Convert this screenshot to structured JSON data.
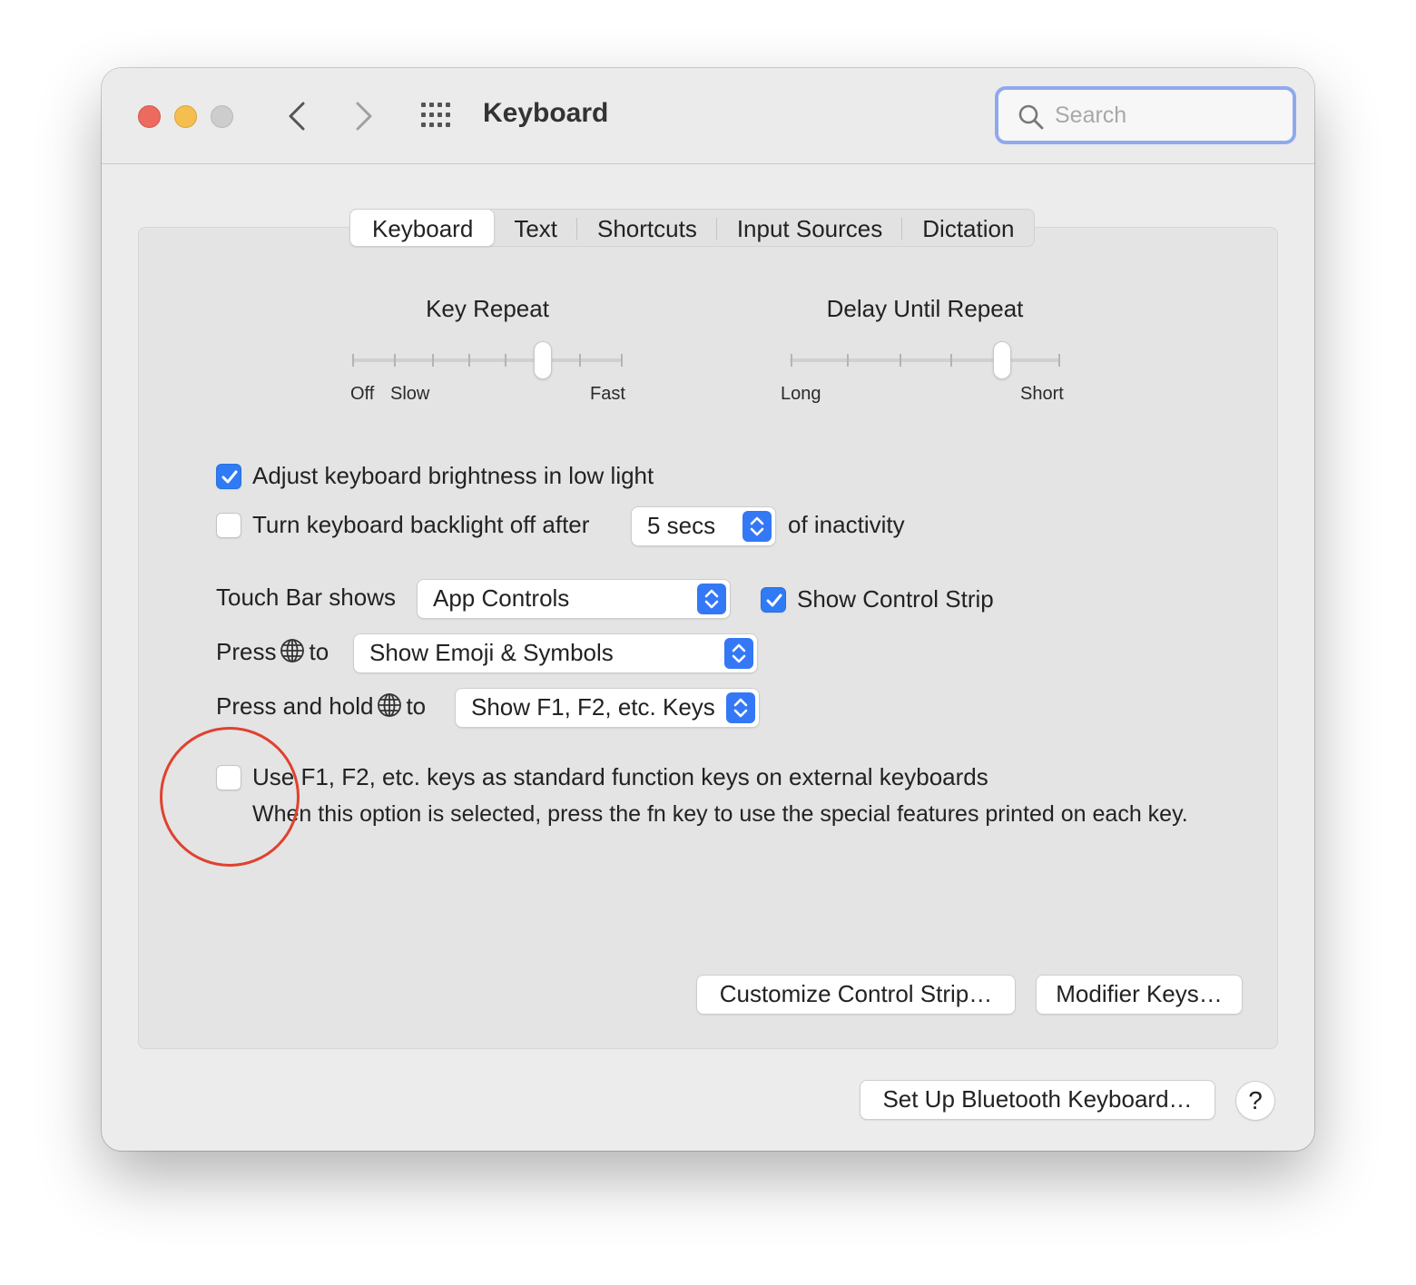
{
  "window": {
    "title": "Keyboard",
    "search": {
      "placeholder": "Search",
      "value": ""
    }
  },
  "tabs": [
    {
      "label": "Keyboard",
      "active": true
    },
    {
      "label": "Text",
      "active": false
    },
    {
      "label": "Shortcuts",
      "active": false
    },
    {
      "label": "Input Sources",
      "active": false
    },
    {
      "label": "Dictation",
      "active": false
    }
  ],
  "key_repeat": {
    "title": "Key Repeat",
    "labels": {
      "off": "Off",
      "slow": "Slow",
      "fast": "Fast"
    },
    "level": 5,
    "positions": 8
  },
  "delay_until_repeat": {
    "title": "Delay Until Repeat",
    "labels": {
      "long": "Long",
      "short": "Short"
    },
    "level": 4,
    "positions": 6
  },
  "options": {
    "adjust_brightness": {
      "label": "Adjust keyboard brightness in low light",
      "checked": true
    },
    "backlight_off": {
      "label": "Turn keyboard backlight off after",
      "checked": false,
      "select_value": "5 secs",
      "suffix": "of inactivity"
    },
    "touch_bar": {
      "label": "Touch Bar shows",
      "select_value": "App Controls"
    },
    "show_control_strip": {
      "label": "Show Control Strip",
      "checked": true
    },
    "press_globe": {
      "prefix": "Press",
      "suffix": "to",
      "select_value": "Show Emoji & Symbols"
    },
    "press_hold_globe": {
      "prefix": "Press and hold",
      "suffix": "to",
      "select_value": "Show F1, F2, etc. Keys"
    },
    "function_keys": {
      "label": "Use F1, F2, etc. keys as standard function keys on external keyboards",
      "description": "When this option is selected, press the fn key to use the special features printed on each key.",
      "checked": false
    }
  },
  "buttons": {
    "customize_control_strip": "Customize Control Strip…",
    "modifier_keys": "Modifier Keys…",
    "bluetooth_keyboard": "Set Up Bluetooth Keyboard…",
    "help": "?"
  },
  "colors": {
    "accent": "#3478f6",
    "annotation": "#e0412f"
  }
}
